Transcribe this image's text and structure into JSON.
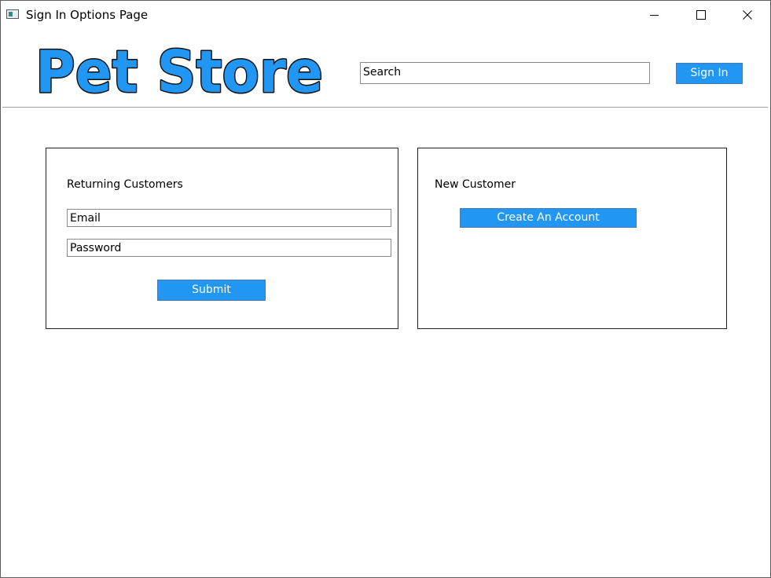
{
  "window": {
    "title": "Sign In Options Page"
  },
  "header": {
    "logo_text": "Pet Store",
    "search": {
      "value": "",
      "placeholder": "Search"
    },
    "sign_in_label": "Sign In"
  },
  "returning": {
    "title": "Returning Customers",
    "email_placeholder": "Email",
    "password_placeholder": "Password",
    "submit_label": "Submit"
  },
  "new_customer": {
    "title": "New Customer",
    "create_label": "Create An Account"
  },
  "colors": {
    "button_bg": "#2196f3",
    "logo_fill": "#2196f3",
    "logo_outline": "#111111"
  },
  "icons": {
    "app": "app-window-icon",
    "minimize": "minimize-icon",
    "maximize": "maximize-icon",
    "close": "close-icon"
  }
}
